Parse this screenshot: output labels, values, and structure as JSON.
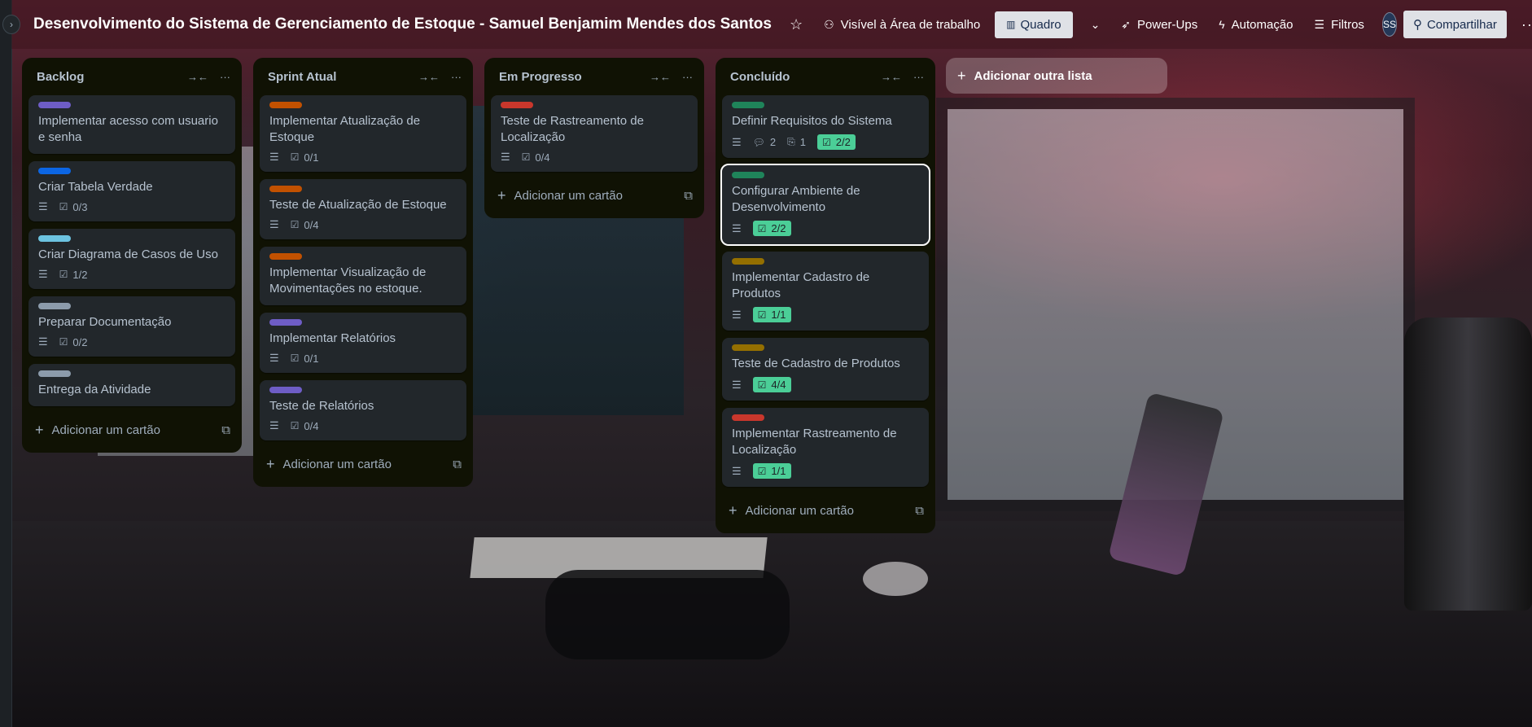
{
  "header": {
    "title": "Desenvolvimento do Sistema de Gerenciamento de Estoque - Samuel Benjamim Mendes dos Santos",
    "visibility": "Visível à Área de trabalho",
    "view": "Quadro",
    "powerups": "Power-Ups",
    "automation": "Automação",
    "filters": "Filtros",
    "avatar": "SS",
    "share": "Compartilhar"
  },
  "colors": {
    "purple": "#6e5dc6",
    "blue": "#0c66e4",
    "sky": "#6cc3e0",
    "gray": "#8c9bab",
    "orange": "#c25100",
    "red": "#c9372c",
    "green": "#1f845a",
    "yellow": "#946f00",
    "done": "#4bce97"
  },
  "lists": [
    {
      "title": "Backlog",
      "add_label": "Adicionar um cartão",
      "cards": [
        {
          "label": "purple",
          "title": "Implementar acesso com usuario e senha"
        },
        {
          "label": "blue",
          "title": "Criar Tabela Verdade",
          "checklist": "0/3"
        },
        {
          "label": "sky",
          "title": "Criar Diagrama de Casos de Uso",
          "checklist": "1/2"
        },
        {
          "label": "gray",
          "title": "Preparar Documentação",
          "checklist": "0/2"
        },
        {
          "label": "gray",
          "title": "Entrega da Atividade"
        }
      ]
    },
    {
      "title": "Sprint Atual",
      "add_label": "Adicionar um cartão",
      "cards": [
        {
          "label": "orange",
          "title": "Implementar Atualização de Estoque",
          "checklist": "0/1"
        },
        {
          "label": "orange",
          "title": "Teste de Atualização de Estoque",
          "checklist": "0/4"
        },
        {
          "label": "orange",
          "title": "Implementar Visualização de Movimentações no estoque."
        },
        {
          "label": "purple",
          "title": "Implementar Relatórios",
          "checklist": "0/1"
        },
        {
          "label": "purple",
          "title": "Teste de Relatórios",
          "checklist": "0/4"
        }
      ]
    },
    {
      "title": "Em Progresso",
      "add_label": "Adicionar um cartão",
      "cards": [
        {
          "label": "red",
          "title": "Teste de Rastreamento de Localização",
          "checklist": "0/4"
        }
      ]
    },
    {
      "title": "Concluído",
      "add_label": "Adicionar um cartão",
      "cards": [
        {
          "label": "green",
          "title": "Definir Requisitos do Sistema",
          "comments": "2",
          "attachments": "1",
          "checklist_done": "2/2"
        },
        {
          "label": "green",
          "title": "Configurar Ambiente de Desenvolvimento",
          "checklist_done": "2/2",
          "selected": true
        },
        {
          "label": "yellow",
          "title": "Implementar Cadastro de Produtos",
          "checklist_done": "1/1"
        },
        {
          "label": "yellow",
          "title": "Teste de Cadastro de Produtos",
          "checklist_done": "4/4"
        },
        {
          "label": "red",
          "title": "Implementar Rastreamento de Localização",
          "checklist_done": "1/1"
        }
      ]
    }
  ],
  "add_list": "Adicionar outra lista",
  "icons": {
    "expand": "chevron-right-icon",
    "star": "star-icon",
    "visibility": "users-icon",
    "board": "board-icon",
    "powerups": "rocket-icon",
    "automation": "lightning-icon",
    "filters": "filter-icon",
    "share": "user-plus-icon",
    "more": "more-icon",
    "collapse": "collapse-icon",
    "description": "description-icon",
    "checklist": "checklist-icon",
    "comment": "comment-icon",
    "attachment": "paperclip-icon",
    "template": "template-icon"
  }
}
